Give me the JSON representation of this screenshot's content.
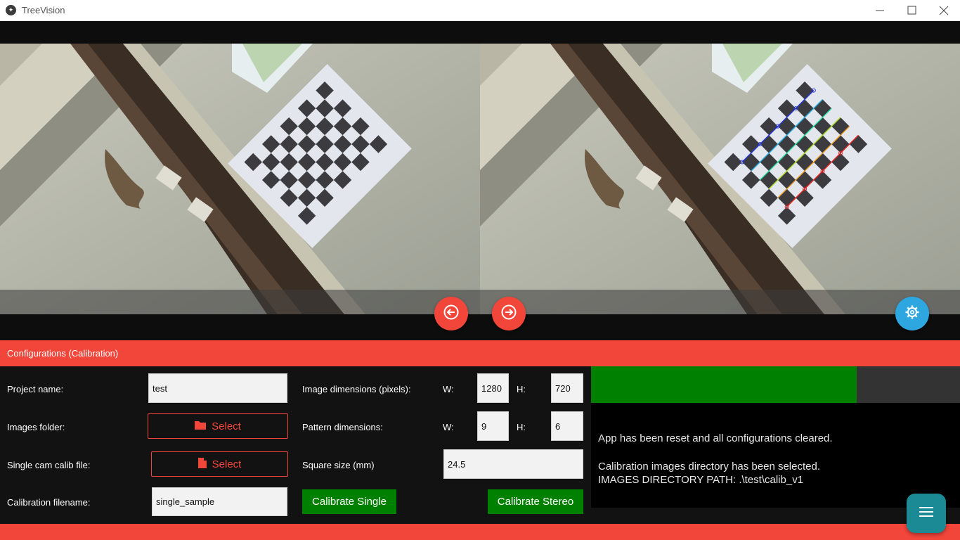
{
  "window": {
    "title": "TreeVision",
    "icon": "kivy-logo-icon"
  },
  "nav": {
    "prev_icon": "arrow-left-circle-icon",
    "next_icon": "arrow-right-circle-icon",
    "settings_icon": "gear-icon"
  },
  "config": {
    "title": "Configurations (Calibration)",
    "project_name_label": "Project name:",
    "project_name_value": "test",
    "images_folder_label": "Images folder:",
    "images_folder_button": "Select",
    "single_cam_label": "Single cam calib file:",
    "single_cam_button": "Select",
    "calib_filename_label": "Calibration filename:",
    "calib_filename_value": "single_sample",
    "image_dims_label": "Image dimensions (pixels):",
    "pattern_dims_label": "Pattern dimensions:",
    "w_label": "W:",
    "h_label": "H:",
    "image_w": "1280",
    "image_h": "720",
    "pattern_w": "9",
    "pattern_h": "6",
    "square_size_label": "Square size (mm)",
    "square_size_value": "24.5",
    "calibrate_single": "Calibrate Single",
    "calibrate_stereo": "Calibrate Stereo"
  },
  "status": {
    "progress": 0.72,
    "progress_color": "#008000",
    "log_line1": "App has been reset and all configurations cleared.",
    "log_line2": "Calibration images directory has been selected.",
    "log_line3": "IMAGES DIRECTORY PATH: .\\test\\calib_v1"
  },
  "colors": {
    "accent_red": "#f2463a",
    "settings_blue": "#2ea6e0",
    "menu_teal": "#1b8a94",
    "action_green": "#008000"
  },
  "menu_icon": "hamburger-menu-icon"
}
